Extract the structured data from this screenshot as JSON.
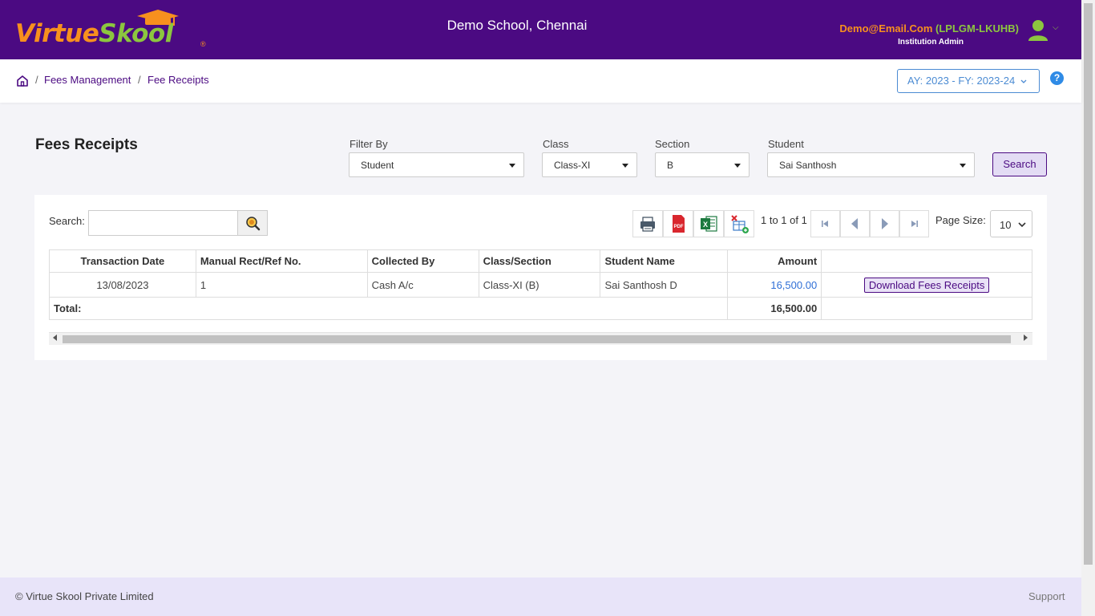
{
  "header": {
    "logo_part1": "Virtue",
    "logo_part2": "Skool",
    "logo_reg": "®",
    "school_name": "Demo School, Chennai",
    "user_email": "Demo@Email.Com",
    "user_code": "(LPLGM-LKUHB)",
    "user_role": "Institution Admin",
    "brand_colors": {
      "primary": "#4b0a82",
      "orange": "#f7901e",
      "green": "#8cc63f"
    }
  },
  "breadcrumb": {
    "items": [
      "Fees Management",
      "Fee Receipts"
    ],
    "separator": "/"
  },
  "academic_year": "AY: 2023 - FY: 2023-24",
  "help_label": "?",
  "page": {
    "title": "Fees Receipts"
  },
  "filters": {
    "filter_by": {
      "label": "Filter By",
      "value": "Student"
    },
    "class": {
      "label": "Class",
      "value": "Class-XI"
    },
    "section": {
      "label": "Section",
      "value": "B"
    },
    "student": {
      "label": "Student",
      "value": "Sai Santhosh"
    },
    "search_button": "Search"
  },
  "grid_toolbar": {
    "search_label": "Search:",
    "search_value": "",
    "tools": [
      "print-icon",
      "pdf-icon",
      "excel-icon",
      "column-chooser-icon"
    ],
    "pager_info": "1 to 1 of 1",
    "page_size_label": "Page Size:",
    "page_size_value": "10"
  },
  "table": {
    "columns": [
      "Transaction Date",
      "Manual Rect/Ref No.",
      "Collected By",
      "Class/Section",
      "Student Name",
      "Amount",
      ""
    ],
    "rows": [
      {
        "date": "13/08/2023",
        "ref": "1",
        "collected_by": "Cash A/c",
        "class_section": "Class-XI (B)",
        "student": "Sai Santhosh D",
        "amount": "16,500.00",
        "action": "Download Fees Receipts"
      }
    ],
    "total_label": "Total:",
    "total_amount": "16,500.00"
  },
  "footer": {
    "copyright": "© Virtue Skool Private Limited",
    "support": "Support"
  }
}
